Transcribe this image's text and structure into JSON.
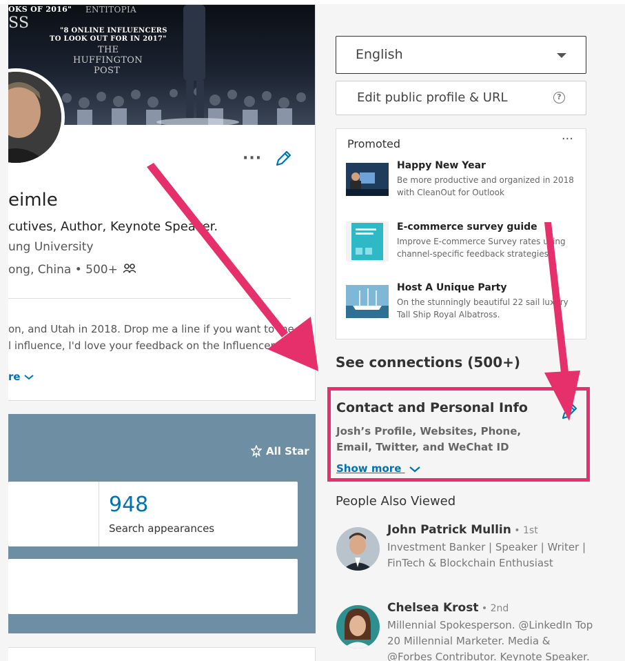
{
  "profile": {
    "cover": {
      "banner_line1": "OKS OF 2016\"",
      "banner_line2": "SS",
      "banner_line3": "\"8 ONLINE INFLUENCERS",
      "banner_line4": "TO LOOK OUT FOR IN 2017\"",
      "banner_line5": "THE",
      "banner_line6": "HUFFINGTON",
      "banner_line7": "POST",
      "banner_line8": "ENTITOPIA"
    },
    "name": "eimle",
    "headline": "cutives, Author, Keynote Speaker.",
    "school": "ung University",
    "location": "ong, China • 500+",
    "summary_line1": "on, and Utah in 2018. Drop me a line if you want to me",
    "summary_line2": "l influence, I'd love your feedback on the Influencer Inc.",
    "show_more": "re"
  },
  "dashboard": {
    "allstar_label": "All Star",
    "stat_value": "948",
    "stat_label": "Search appearances"
  },
  "sidebar": {
    "language": "English",
    "edit_public_profile": "Edit public profile & URL",
    "promoted_label": "Promoted",
    "more_dots": "···",
    "ads": [
      {
        "title": "Happy New Year",
        "desc": "Be more productive and organized in 2018 with CleanOut for Outlook"
      },
      {
        "title": "E-commerce survey guide",
        "desc": "Improve E-commerce Survey rates using channel-specific feedback strategies"
      },
      {
        "title": "Host A Unique Party",
        "desc": "On the stunningly beautiful 22 sail luxury Tall Ship Royal Albatross."
      }
    ],
    "see_connections": "See connections (500+)",
    "contact": {
      "title": "Contact and Personal Info",
      "desc": "Josh’s Profile, Websites, Phone, Email, Twitter, and WeChat ID",
      "show_more": "Show more"
    },
    "people_also_viewed": "People Also Viewed",
    "people": [
      {
        "name": "John Patrick Mullin",
        "degree": " • 1st",
        "headline": "Investment Banker | Speaker | Writer | FinTech & Blockchain Enthusiast"
      },
      {
        "name": "Chelsea Krost",
        "degree": " • 2nd",
        "headline": "Millennial Spokesperson. @LinkedIn Top 20 Millennial Marketer. Media & @Forbes Contributor. Keynote Speaker. Author"
      }
    ]
  },
  "colors": {
    "accent_link": "#0073b1",
    "annotation_pink": "#e6306b",
    "dashboard_bg": "#6d8ea3"
  }
}
